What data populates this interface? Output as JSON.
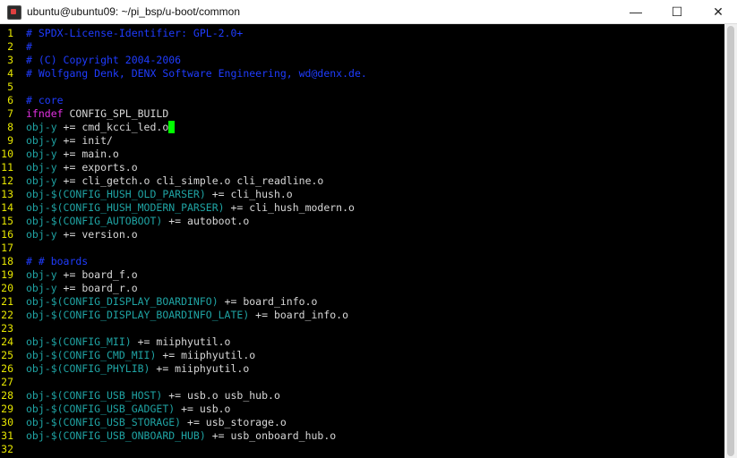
{
  "window": {
    "title": "ubuntu@ubuntu09: ~/pi_bsp/u-boot/common",
    "minimize_glyph": "—",
    "maximize_glyph": "☐",
    "close_glyph": "✕"
  },
  "colors": {
    "line_number": "#e6e600",
    "comment": "#1f3cff",
    "keyword": "#e030e0",
    "variable": "#1fa3a3",
    "text": "#d8d8d8",
    "cursor": "#00ff00"
  },
  "editor": {
    "lines": [
      {
        "num": "1",
        "segs": [
          [
            "cmt",
            "# SPDX-License-Identifier: GPL-2.0+"
          ]
        ]
      },
      {
        "num": "2",
        "segs": [
          [
            "cmt",
            "#"
          ]
        ]
      },
      {
        "num": "3",
        "segs": [
          [
            "cmt",
            "# (C) Copyright 2004-2006"
          ]
        ]
      },
      {
        "num": "4",
        "segs": [
          [
            "cmt",
            "# Wolfgang Denk, DENX Software Engineering, wd@denx.de."
          ]
        ]
      },
      {
        "num": "5",
        "segs": []
      },
      {
        "num": "6",
        "segs": [
          [
            "cmt",
            "# core"
          ]
        ]
      },
      {
        "num": "7",
        "segs": [
          [
            "kw",
            "ifndef"
          ],
          [
            "txt",
            " CONFIG_SPL_BUILD"
          ]
        ]
      },
      {
        "num": "8",
        "segs": [
          [
            "var",
            "obj-y"
          ],
          [
            "txt",
            " += cmd_kcci_led.o"
          ],
          [
            "cursor",
            " "
          ]
        ]
      },
      {
        "num": "9",
        "segs": [
          [
            "var",
            "obj-y"
          ],
          [
            "txt",
            " += init/"
          ]
        ]
      },
      {
        "num": "10",
        "segs": [
          [
            "var",
            "obj-y"
          ],
          [
            "txt",
            " += main.o"
          ]
        ]
      },
      {
        "num": "11",
        "segs": [
          [
            "var",
            "obj-y"
          ],
          [
            "txt",
            " += exports.o"
          ]
        ]
      },
      {
        "num": "12",
        "segs": [
          [
            "var",
            "obj-y"
          ],
          [
            "txt",
            " += cli_getch.o cli_simple.o cli_readline.o"
          ]
        ]
      },
      {
        "num": "13",
        "segs": [
          [
            "var",
            "obj-$(CONFIG_HUSH_OLD_PARSER)"
          ],
          [
            "txt",
            " += cli_hush.o"
          ]
        ]
      },
      {
        "num": "14",
        "segs": [
          [
            "var",
            "obj-$(CONFIG_HUSH_MODERN_PARSER)"
          ],
          [
            "txt",
            " += cli_hush_modern.o"
          ]
        ]
      },
      {
        "num": "15",
        "segs": [
          [
            "var",
            "obj-$(CONFIG_AUTOBOOT)"
          ],
          [
            "txt",
            " += autoboot.o"
          ]
        ]
      },
      {
        "num": "16",
        "segs": [
          [
            "var",
            "obj-y"
          ],
          [
            "txt",
            " += version.o"
          ]
        ]
      },
      {
        "num": "17",
        "segs": []
      },
      {
        "num": "18",
        "segs": [
          [
            "cmt",
            "# # boards"
          ]
        ]
      },
      {
        "num": "19",
        "segs": [
          [
            "var",
            "obj-y"
          ],
          [
            "txt",
            " += board_f.o"
          ]
        ]
      },
      {
        "num": "20",
        "segs": [
          [
            "var",
            "obj-y"
          ],
          [
            "txt",
            " += board_r.o"
          ]
        ]
      },
      {
        "num": "21",
        "segs": [
          [
            "var",
            "obj-$(CONFIG_DISPLAY_BOARDINFO)"
          ],
          [
            "txt",
            " += board_info.o"
          ]
        ]
      },
      {
        "num": "22",
        "segs": [
          [
            "var",
            "obj-$(CONFIG_DISPLAY_BOARDINFO_LATE)"
          ],
          [
            "txt",
            " += board_info.o"
          ]
        ]
      },
      {
        "num": "23",
        "segs": []
      },
      {
        "num": "24",
        "segs": [
          [
            "var",
            "obj-$(CONFIG_MII)"
          ],
          [
            "txt",
            " += miiphyutil.o"
          ]
        ]
      },
      {
        "num": "25",
        "segs": [
          [
            "var",
            "obj-$(CONFIG_CMD_MII)"
          ],
          [
            "txt",
            " += miiphyutil.o"
          ]
        ]
      },
      {
        "num": "26",
        "segs": [
          [
            "var",
            "obj-$(CONFIG_PHYLIB)"
          ],
          [
            "txt",
            " += miiphyutil.o"
          ]
        ]
      },
      {
        "num": "27",
        "segs": []
      },
      {
        "num": "28",
        "segs": [
          [
            "var",
            "obj-$(CONFIG_USB_HOST)"
          ],
          [
            "txt",
            " += usb.o usb_hub.o"
          ]
        ]
      },
      {
        "num": "29",
        "segs": [
          [
            "var",
            "obj-$(CONFIG_USB_GADGET)"
          ],
          [
            "txt",
            " += usb.o"
          ]
        ]
      },
      {
        "num": "30",
        "segs": [
          [
            "var",
            "obj-$(CONFIG_USB_STORAGE)"
          ],
          [
            "txt",
            " += usb_storage.o"
          ]
        ]
      },
      {
        "num": "31",
        "segs": [
          [
            "var",
            "obj-$(CONFIG_USB_ONBOARD_HUB)"
          ],
          [
            "txt",
            " += usb_onboard_hub.o"
          ]
        ]
      },
      {
        "num": "32",
        "segs": []
      }
    ]
  }
}
